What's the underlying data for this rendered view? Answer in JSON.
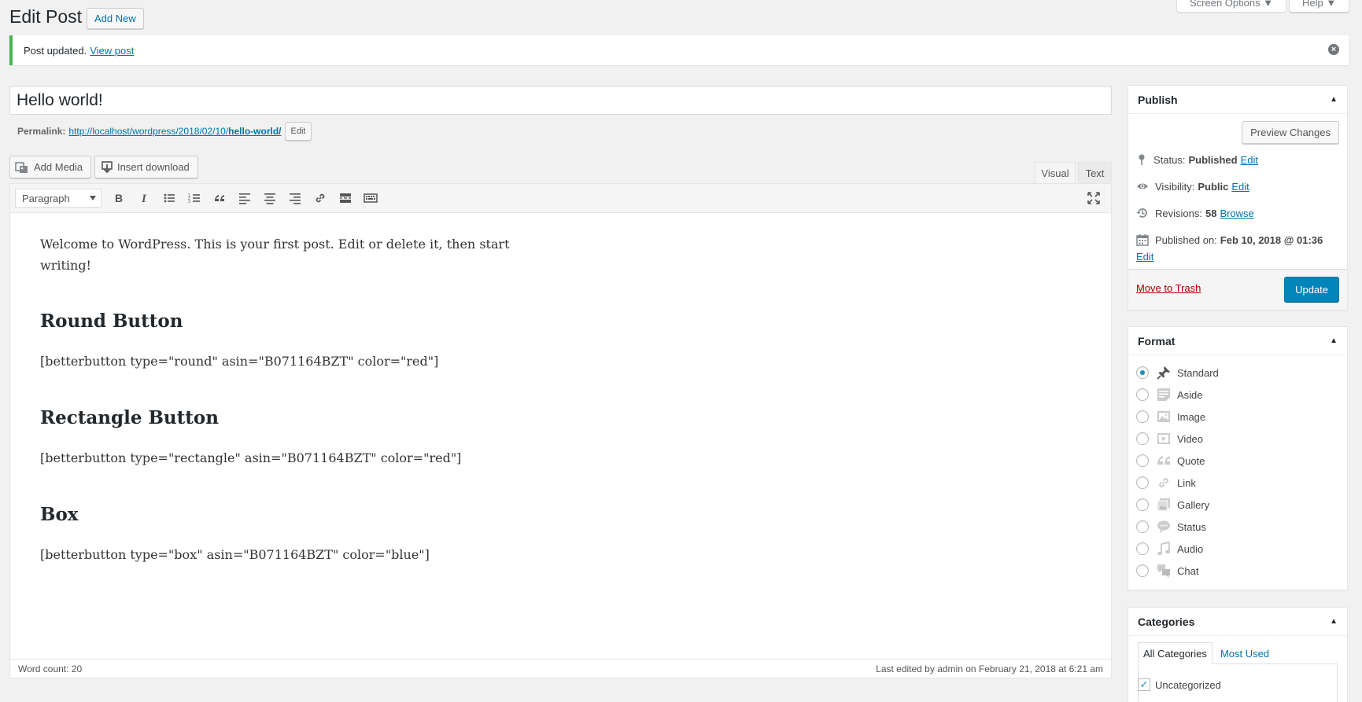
{
  "header": {
    "title": "Edit Post",
    "add_new": "Add New",
    "screen_options": "Screen Options ▼",
    "help": "Help ▼"
  },
  "notice": {
    "text": "Post updated.",
    "link": "View post"
  },
  "post": {
    "title": "Hello world!",
    "permalink_label": "Permalink:",
    "permalink_base": "http://localhost/wordpress/2018/02/10/",
    "permalink_slug": "hello-world/",
    "permalink_edit": "Edit"
  },
  "media": {
    "add_media": "Add Media",
    "insert_download": "Insert download"
  },
  "editor": {
    "tab_visual": "Visual",
    "tab_text": "Text",
    "format_select": "Paragraph",
    "content": {
      "intro": "Welcome to WordPress. This is your first post. Edit or delete it, then start writing!",
      "h_round": "Round Button",
      "sc_round": "[betterbutton type=\"round\" asin=\"B071164BZT\" color=\"red\"]",
      "h_rect": "Rectangle Button",
      "sc_rect": "[betterbutton type=\"rectangle\" asin=\"B071164BZT\" color=\"red\"]",
      "h_box": "Box",
      "sc_box": "[betterbutton type=\"box\" asin=\"B071164BZT\" color=\"blue\"]"
    },
    "word_count": "Word count: 20",
    "last_edited": "Last edited by admin on February 21, 2018 at 6:21 am"
  },
  "publish": {
    "heading": "Publish",
    "preview": "Preview Changes",
    "status_label": "Status:",
    "status_value": "Published",
    "status_edit": "Edit",
    "visibility_label": "Visibility:",
    "visibility_value": "Public",
    "visibility_edit": "Edit",
    "revisions_label": "Revisions:",
    "revisions_value": "58",
    "revisions_browse": "Browse",
    "published_label": "Published on:",
    "published_value": "Feb 10, 2018 @ 01:36",
    "published_edit": "Edit",
    "trash": "Move to Trash",
    "update": "Update"
  },
  "format": {
    "heading": "Format",
    "items": [
      "Standard",
      "Aside",
      "Image",
      "Video",
      "Quote",
      "Link",
      "Gallery",
      "Status",
      "Audio",
      "Chat"
    ],
    "selected": "Standard"
  },
  "categories": {
    "heading": "Categories",
    "tab_all": "All Categories",
    "tab_most": "Most Used",
    "item": "Uncategorized"
  },
  "colors": {
    "accent": "#0085ba",
    "link": "#0073aa",
    "success": "#46b450",
    "trash": "#aa0000"
  }
}
